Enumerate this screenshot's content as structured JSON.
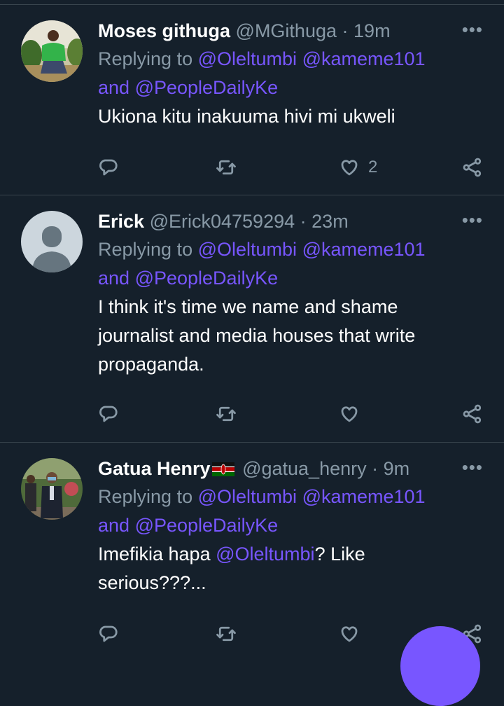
{
  "tweets": [
    {
      "name": "Moses githuga",
      "handle": "@MGithuga",
      "time": "19m",
      "more": "•••",
      "replying_prefix": "Replying to",
      "mention1": "@Oleltumbi",
      "mention2": "@kameme101",
      "and_text": "and",
      "mention3": "@PeopleDailyKe",
      "text": "Ukiona kitu inakuuma hivi mi ukweli",
      "like_count": "2"
    },
    {
      "name": "Erick",
      "handle": "@Erick04759294",
      "time": "23m",
      "more": "•••",
      "replying_prefix": "Replying to",
      "mention1": "@Oleltumbi",
      "mention2": "@kameme101",
      "and_text": "and",
      "mention3": "@PeopleDailyKe",
      "text_line1": "I think it's time we name and shame",
      "text_line2": "journalist and media houses that write",
      "text_line3": "propaganda."
    },
    {
      "name": "Gatua Henry",
      "handle": "@gatua_henry",
      "time": "9m",
      "more": "•••",
      "replying_prefix": "Replying to",
      "mention1": "@Oleltumbi",
      "mention2": "@kameme101",
      "and_text": "and",
      "mention3": "@PeopleDailyKe",
      "text_before": "Imefikia hapa",
      "text_mention": "@Oleltumbi",
      "text_after": "? Like",
      "text_line2": "serious???..."
    }
  ],
  "colors": {
    "background": "#15202b",
    "secondary_text": "#8899a6",
    "mention": "#7856ff",
    "divider": "#38444d",
    "fab": "#7856ff"
  },
  "icons": [
    "reply-icon",
    "retweet-icon",
    "like-icon",
    "share-icon",
    "more-icon",
    "kenya-flag-icon"
  ]
}
